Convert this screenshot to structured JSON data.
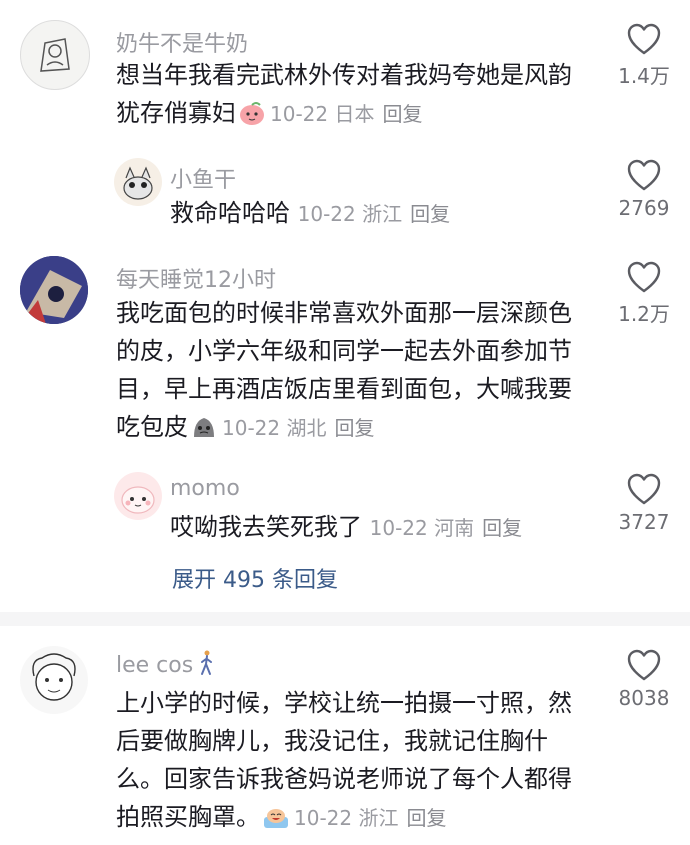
{
  "comments": [
    {
      "username": "奶牛不是牛奶",
      "text_lines": [
        "想当年我看完武林外传对着我妈夸她是风韵",
        "犹存俏寡妇"
      ],
      "date": "10-22",
      "location": "日本",
      "reply_label": "回复",
      "likes": "1.4万",
      "emoji_icon": "peach-face-emoji"
    },
    {
      "username": "小鱼干",
      "text_lines": [
        "救命哈哈哈"
      ],
      "date": "10-22",
      "location": "浙江",
      "reply_label": "回复",
      "likes": "2769"
    },
    {
      "username": "每天睡觉12小时",
      "text_lines": [
        "我吃面包的时候非常喜欢外面那一层深颜色",
        "的皮，小学六年级和同学一起去外面参加节",
        "目，早上再酒店饭店里看到面包，大喊我要",
        "吃包皮"
      ],
      "date": "10-22",
      "location": "湖北",
      "reply_label": "回复",
      "likes": "1.2万",
      "emoji_icon": "grey-blob-emoji"
    },
    {
      "username": "momo",
      "text_lines": [
        "哎呦我去笑死我了"
      ],
      "date": "10-22",
      "location": "河南",
      "reply_label": "回复",
      "likes": "3727"
    },
    {
      "username": "lee cos",
      "text_lines": [
        "上小学的时候，学校让统一拍摄一寸照，然",
        "后要做胸牌儿，我没记住，我就记住胸什",
        "么。回家告诉我爸妈说老师说了每个人都得",
        "拍照买胸罩。"
      ],
      "date": "10-22",
      "location": "浙江",
      "reply_label": "回复",
      "likes": "8038",
      "emoji_icon": "laughing-bath-emoji",
      "name_icon": "walking-person-icon"
    }
  ],
  "expand_replies": "展开 495 条回复",
  "colors": {
    "accent": "#3b5b89",
    "muted": "#9a9ba1",
    "text": "#1b1b22"
  }
}
